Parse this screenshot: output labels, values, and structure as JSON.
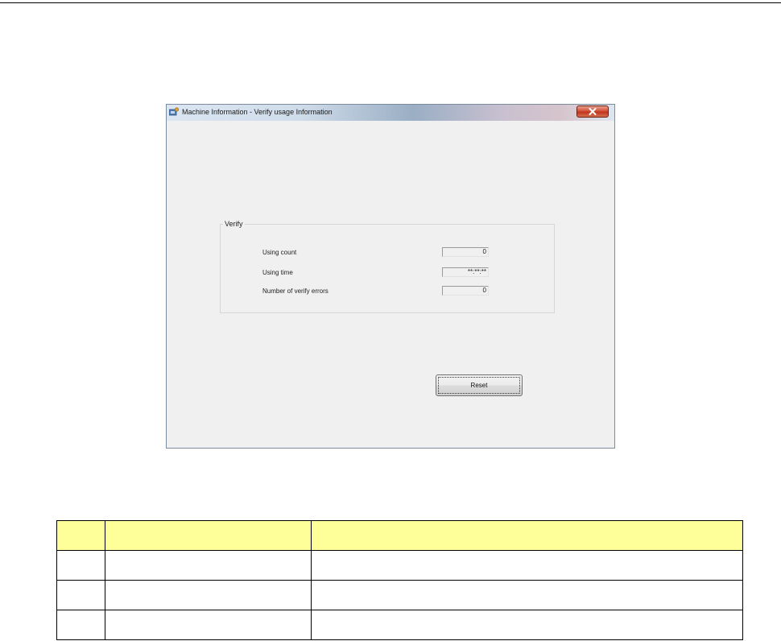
{
  "window": {
    "title": "Machine Information - Verify usage Information"
  },
  "verify_group": {
    "legend": "Verify",
    "fields": [
      {
        "label": "Using count",
        "value": "0"
      },
      {
        "label": "Using time",
        "value": "**:**:**"
      },
      {
        "label": "Number of verify errors",
        "value": "0"
      }
    ]
  },
  "reset_button": {
    "label": "Reset"
  },
  "table": {
    "header_color": "#ffff99",
    "headers": [
      "",
      "",
      ""
    ],
    "rows": [
      [
        "",
        "",
        ""
      ],
      [
        "",
        "",
        ""
      ],
      [
        "",
        "",
        ""
      ]
    ]
  }
}
